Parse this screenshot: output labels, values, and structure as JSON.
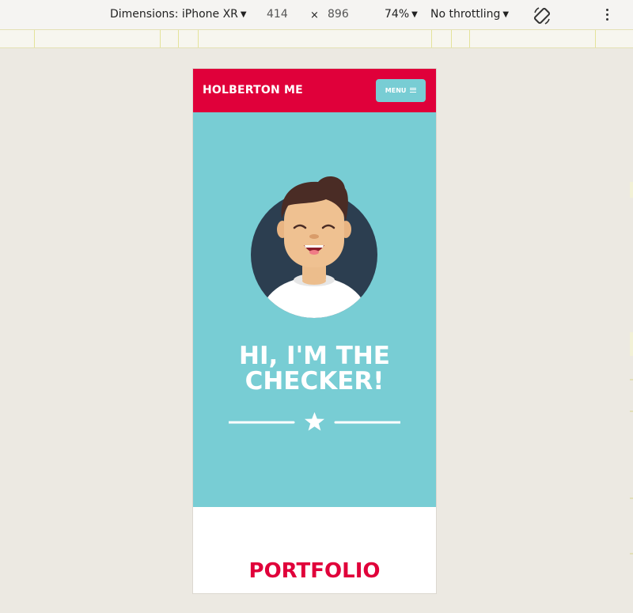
{
  "devtools": {
    "dimensions_label": "Dimensions: iPhone XR",
    "width": "414",
    "times": "×",
    "height": "896",
    "zoom": "74%",
    "throttling": "No throttling",
    "icons": [
      "rotate-icon",
      "more-options-icon"
    ]
  },
  "site": {
    "logo": "HOLBERTON ME",
    "menu_label": "MENU",
    "hero_title": "HI, I'M THE CHECKER!",
    "section_title": "PORTFOLIO",
    "colors": {
      "primary": "#e0003a",
      "hero_bg": "#78cdd4",
      "avatar_bg": "#2c3e50",
      "white": "#ffffff"
    }
  }
}
